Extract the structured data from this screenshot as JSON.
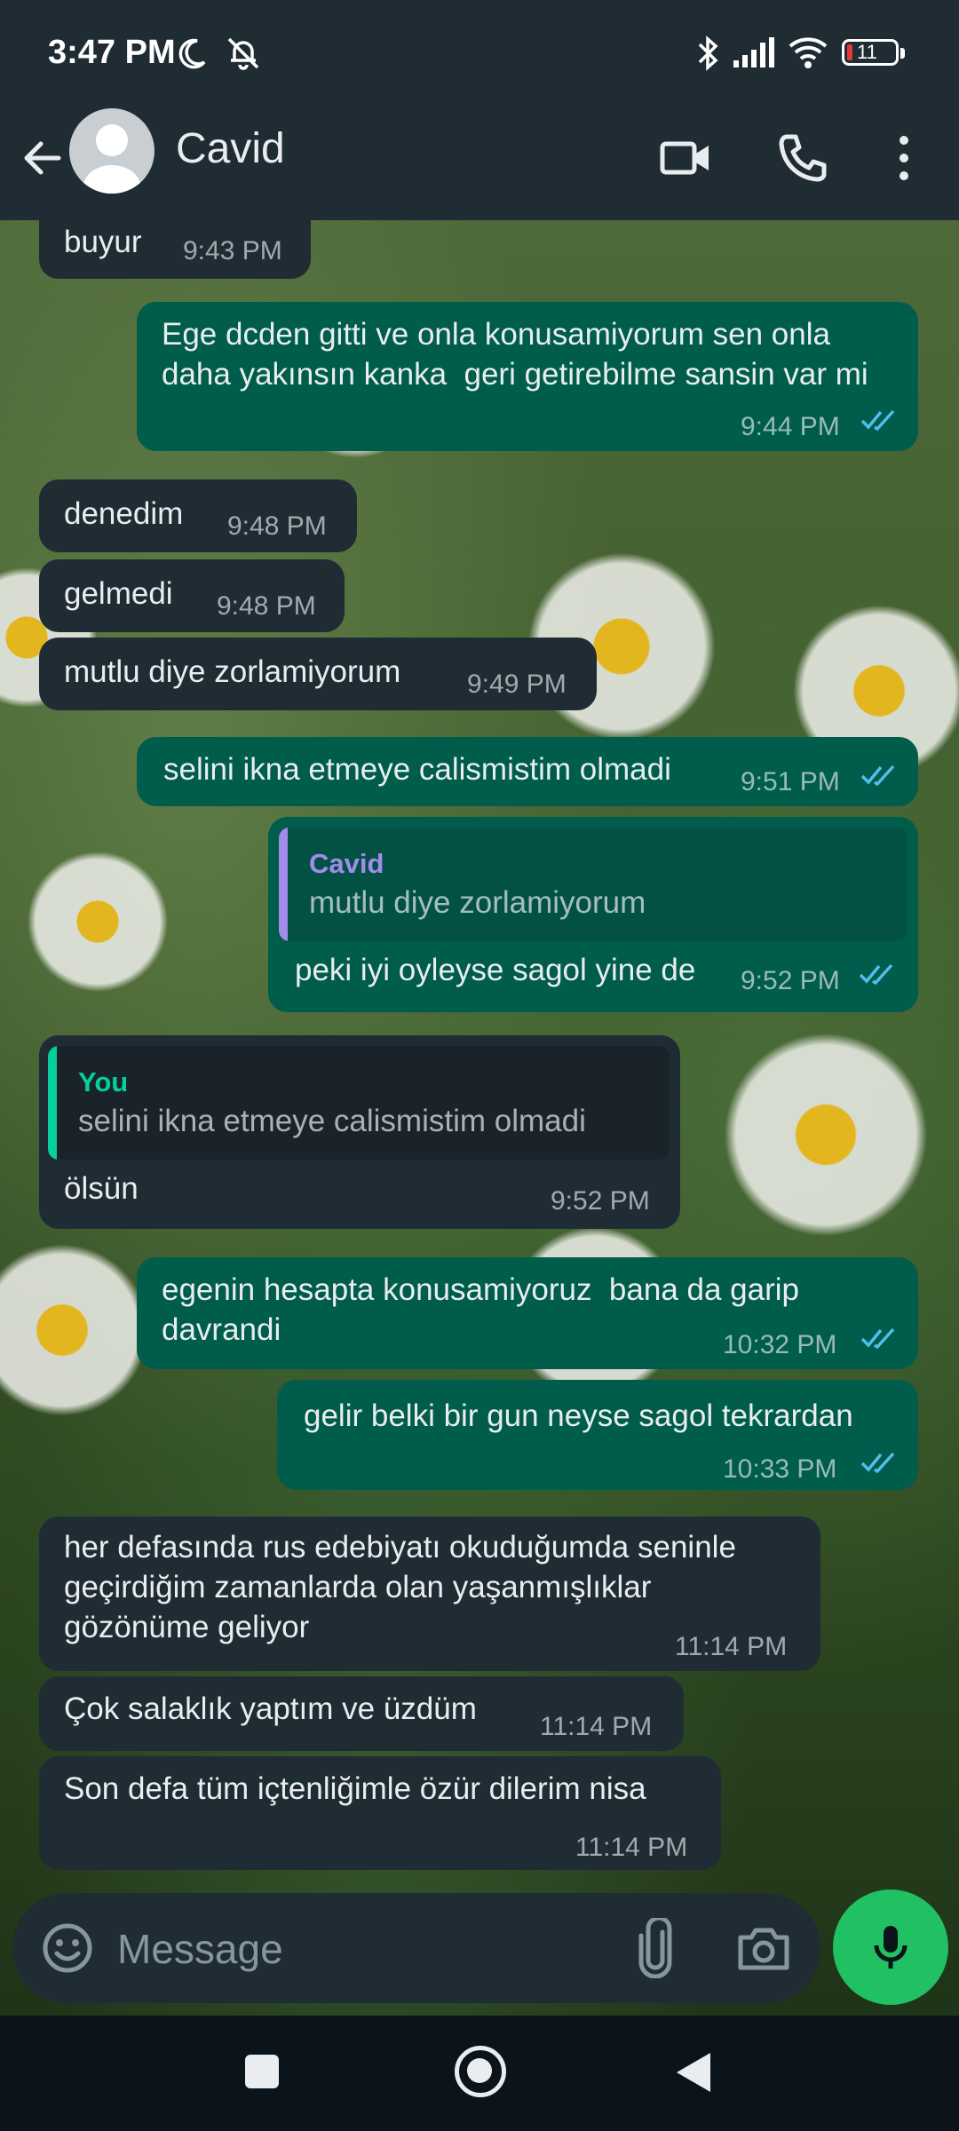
{
  "status": {
    "time": "3:47 PM",
    "battery": "11"
  },
  "header": {
    "contact_name": "Cavid",
    "icons": [
      "back-arrow-icon",
      "avatar",
      "video-call-icon",
      "voice-call-icon",
      "more-options-icon"
    ]
  },
  "messages": [
    {
      "dir": "in",
      "text": "buyur",
      "time": "9:43 PM"
    },
    {
      "dir": "out",
      "text": "Ege dcden gitti ve onla konusamiyorum sen onla daha yakınsın kanka  geri getirebilme sansin var mi",
      "time": "9:44 PM",
      "read": true
    },
    {
      "dir": "in",
      "text": "denedim",
      "time": "9:48 PM"
    },
    {
      "dir": "in",
      "text": "gelmedi",
      "time": "9:48 PM"
    },
    {
      "dir": "in",
      "text": "mutlu diye zorlamiyorum",
      "time": "9:49 PM"
    },
    {
      "dir": "out",
      "text": "selini ikna etmeye calismistim olmadi",
      "time": "9:51 PM",
      "read": true
    },
    {
      "dir": "out",
      "quote": {
        "author": "Cavid",
        "text": "mutlu diye zorlamiyorum"
      },
      "text": "peki iyi oyleyse sagol yine de",
      "time": "9:52 PM",
      "read": true
    },
    {
      "dir": "in",
      "quote": {
        "author": "You",
        "text": "selini ikna etmeye calismistim olmadi"
      },
      "text": "ölsün",
      "time": "9:52 PM"
    },
    {
      "dir": "out",
      "text": "egenin hesapta konusamiyoruz  bana da garip davrandi",
      "time": "10:32 PM",
      "read": true
    },
    {
      "dir": "out",
      "text": "gelir belki bir gun neyse sagol tekrardan",
      "time": "10:33 PM",
      "read": true
    },
    {
      "dir": "in",
      "text": "her defasında rus edebiyatı okuduğumda seninle geçirdiğim zamanlarda olan yaşanmışlıklar gözönüme geliyor",
      "time": "11:14 PM"
    },
    {
      "dir": "in",
      "text": "Çok salaklık yaptım ve üzdüm",
      "time": "11:14 PM"
    },
    {
      "dir": "in",
      "text": "Son defa tüm içtenliğimle özür dilerim nisa",
      "time": "11:14 PM"
    }
  ],
  "composer": {
    "placeholder": "Message"
  },
  "colors": {
    "incoming_bubble": "#1f2c34",
    "outgoing_bubble": "#005c4b",
    "accent_green": "#21c063",
    "read_ticks": "#53bdeb",
    "quote_you": "#06cf9c",
    "quote_cavid": "#a38bea"
  }
}
